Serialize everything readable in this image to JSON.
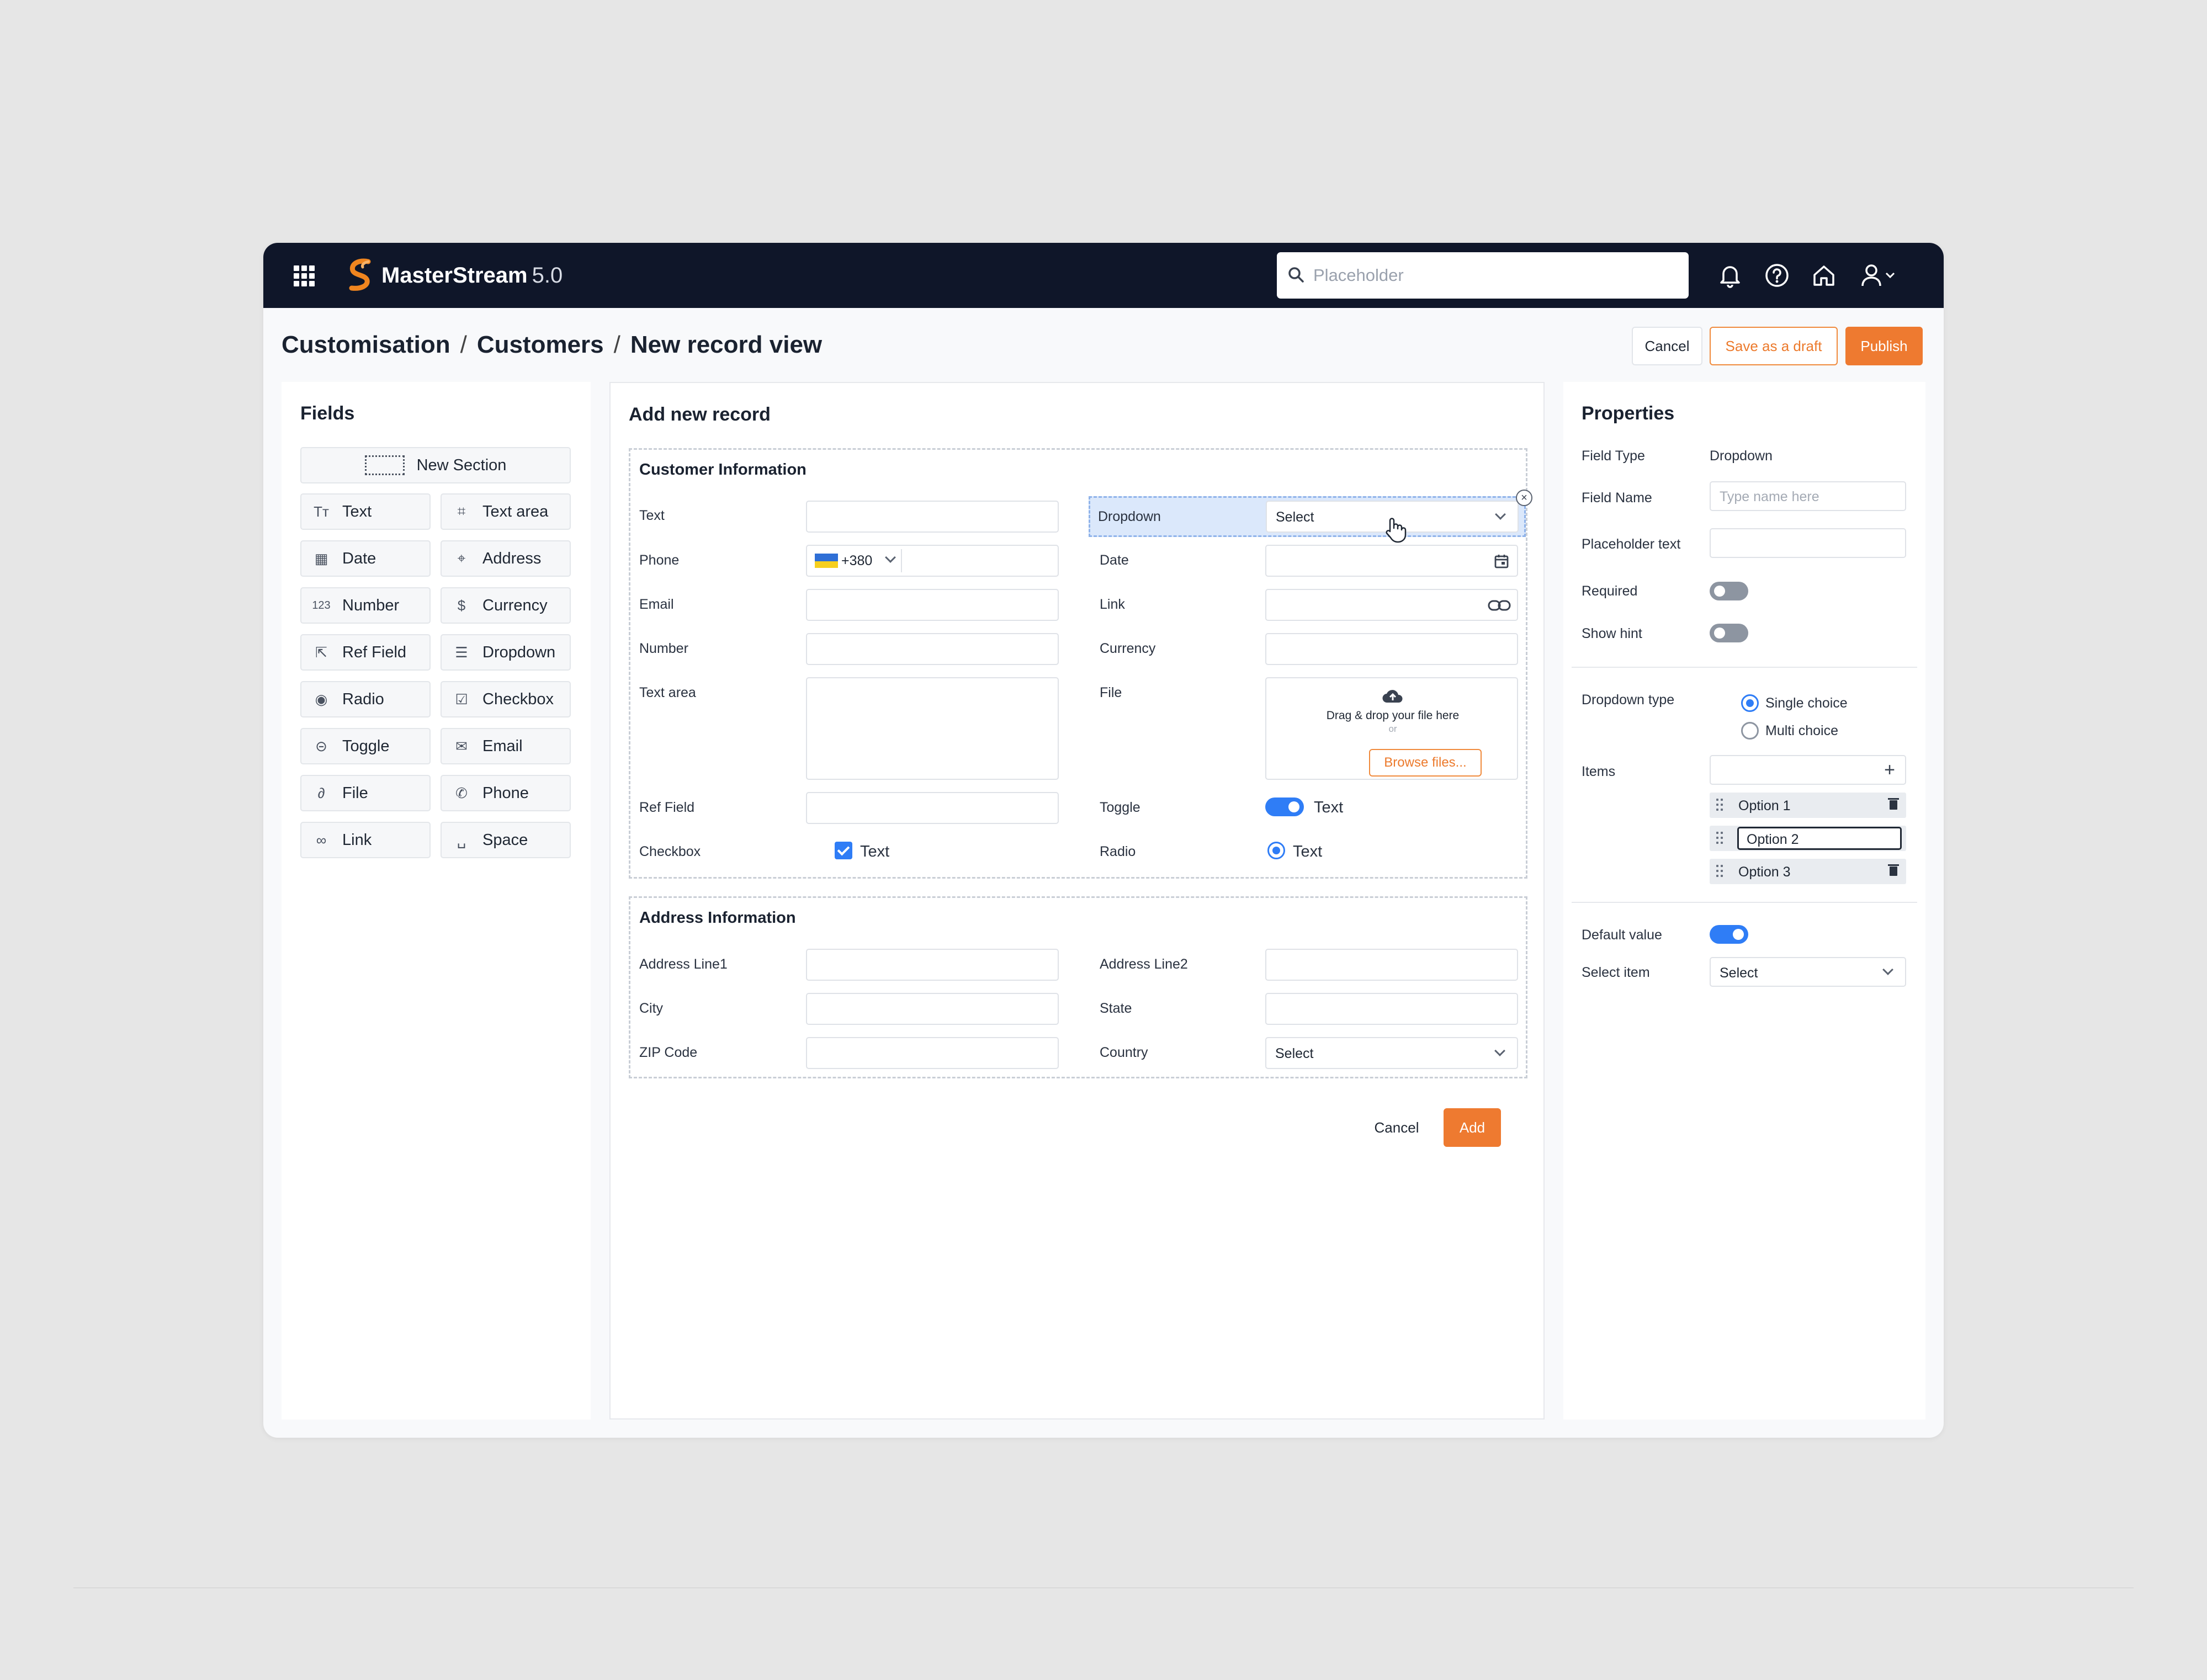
{
  "app": {
    "name": "MasterStream",
    "version": "5.0"
  },
  "search": {
    "placeholder": "Placeholder"
  },
  "breadcrumb": [
    "Customisation",
    "Customers",
    "New record view"
  ],
  "header_actions": {
    "cancel": "Cancel",
    "save_draft": "Save as a draft",
    "publish": "Publish"
  },
  "fields_panel": {
    "title": "Fields",
    "new_section": "New Section",
    "items": [
      {
        "label": "Text",
        "icon": "text-type-icon"
      },
      {
        "label": "Text area",
        "icon": "text-area-icon"
      },
      {
        "label": "Date",
        "icon": "calendar-icon"
      },
      {
        "label": "Address",
        "icon": "map-pin-icon"
      },
      {
        "label": "Number",
        "icon": "number-icon"
      },
      {
        "label": "Currency",
        "icon": "dollar-icon"
      },
      {
        "label": "Ref Field",
        "icon": "ref-cursor-icon"
      },
      {
        "label": "Dropdown",
        "icon": "dropdown-list-icon"
      },
      {
        "label": "Radio",
        "icon": "radio-icon"
      },
      {
        "label": "Checkbox",
        "icon": "checkbox-icon"
      },
      {
        "label": "Toggle",
        "icon": "toggle-icon"
      },
      {
        "label": "Email",
        "icon": "mail-icon"
      },
      {
        "label": "File",
        "icon": "paperclip-icon"
      },
      {
        "label": "Phone",
        "icon": "phone-icon"
      },
      {
        "label": "Link",
        "icon": "link-icon"
      },
      {
        "label": "Space",
        "icon": "space-icon"
      }
    ]
  },
  "form": {
    "title": "Add new record",
    "customer_section": {
      "title": "Customer Information",
      "labels": {
        "text": "Text",
        "phone": "Phone",
        "email": "Email",
        "number": "Number",
        "text_area": "Text area",
        "ref_field": "Ref Field",
        "checkbox": "Checkbox",
        "dropdown": "Dropdown",
        "date": "Date",
        "link": "Link",
        "currency": "Currency",
        "file": "File",
        "toggle": "Toggle",
        "radio": "Radio"
      },
      "phone_code": "+380",
      "dropdown_value": "Select",
      "file_drop_text": "Drag & drop your file here",
      "file_or": "or",
      "browse_button": "Browse files...",
      "toggle_text": "Text",
      "radio_text": "Text",
      "checkbox_text": "Text"
    },
    "address_section": {
      "title": "Address Information",
      "labels": {
        "address1": "Address Line1",
        "address2": "Address Line2",
        "city": "City",
        "state": "State",
        "zip": "ZIP Code",
        "country": "Country"
      },
      "country_value": "Select"
    },
    "cancel": "Cancel",
    "add": "Add"
  },
  "properties": {
    "title": "Properties",
    "field_type_label": "Field Type",
    "field_type_value": "Dropdown",
    "field_name_label": "Field Name",
    "field_name_placeholder": "Type name here",
    "placeholder_label": "Placeholder text",
    "required_label": "Required",
    "required_on": false,
    "show_hint_label": "Show hint",
    "show_hint_on": false,
    "dropdown_type_label": "Dropdown type",
    "single_choice": "Single choice",
    "multi_choice": "Multi choice",
    "selected_type": "Single choice",
    "items_label": "Items",
    "items": [
      "Option 1",
      "Option 2",
      "Option 3"
    ],
    "default_value_label": "Default value",
    "default_value_on": true,
    "select_item_label": "Select item",
    "select_item_value": "Select"
  },
  "colors": {
    "topbar": "#0f1629",
    "accent": "#ee7a30",
    "toggle_on": "#2f7df6"
  }
}
